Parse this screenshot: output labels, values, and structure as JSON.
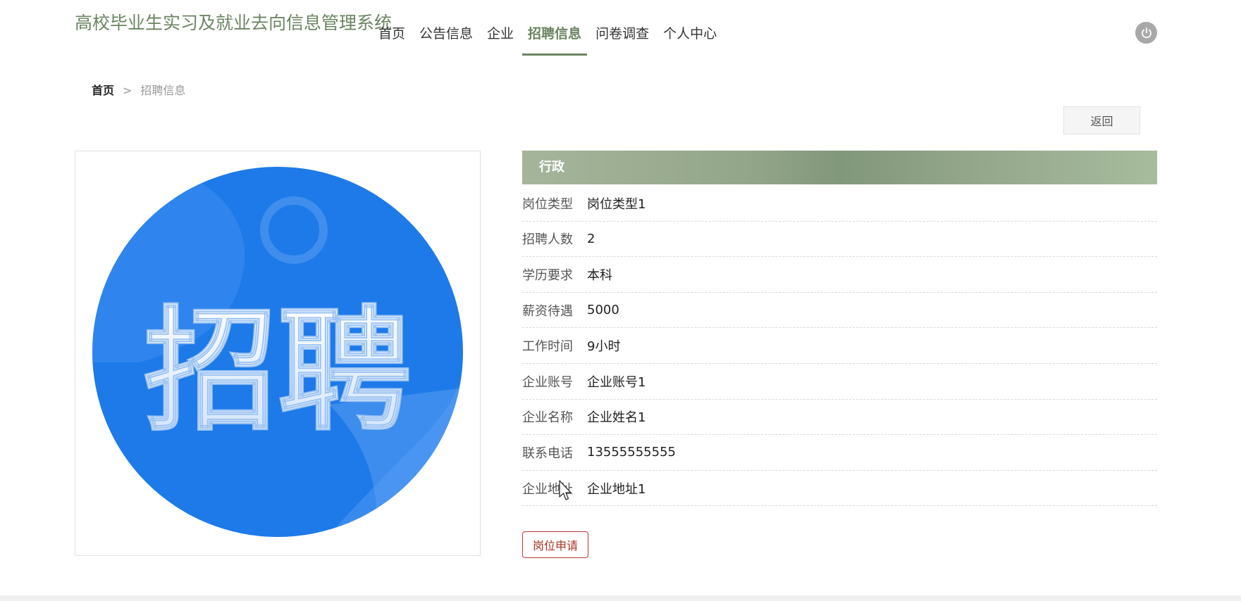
{
  "header": {
    "title": "高校毕业生实习及就业去向信息管理系统",
    "nav": [
      {
        "label": "首页",
        "active": false
      },
      {
        "label": "公告信息",
        "active": false
      },
      {
        "label": "企业",
        "active": false
      },
      {
        "label": "招聘信息",
        "active": true
      },
      {
        "label": "问卷调查",
        "active": false
      },
      {
        "label": "个人中心",
        "active": false
      }
    ],
    "logout_icon": "power-icon"
  },
  "breadcrumb": {
    "home": "首页",
    "separator": ">",
    "current": "招聘信息"
  },
  "back_button": "返回",
  "image": {
    "text": "招聘",
    "icon": "recruit-image"
  },
  "detail": {
    "title": "行政",
    "rows": [
      {
        "label": "岗位类型",
        "value": "岗位类型1"
      },
      {
        "label": "招聘人数",
        "value": "2"
      },
      {
        "label": "学历要求",
        "value": "本科"
      },
      {
        "label": "薪资待遇",
        "value": "5000"
      },
      {
        "label": "工作时间",
        "value": "9小时"
      },
      {
        "label": "企业账号",
        "value": "企业账号1"
      },
      {
        "label": "企业名称",
        "value": "企业姓名1"
      },
      {
        "label": "联系电话",
        "value": "13555555555"
      },
      {
        "label": "企业地址",
        "value": "企业地址1"
      }
    ]
  },
  "apply_button": "岗位申请",
  "colors": {
    "accent": "#6b8461",
    "apply": "#b23a30",
    "image_blue": "#1e7ae8"
  }
}
